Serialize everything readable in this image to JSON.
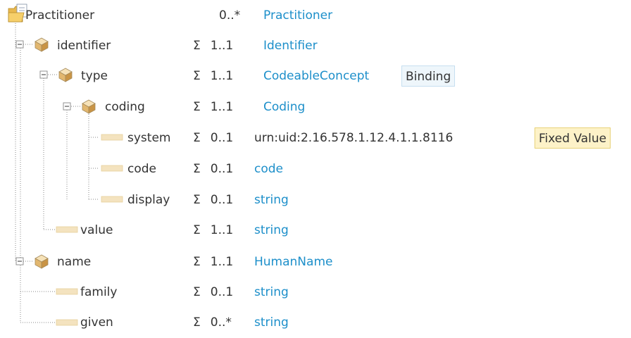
{
  "tree": {
    "rows": [
      {
        "name": "Practitioner",
        "flags": "",
        "card": "0..*",
        "type": "Practitioner",
        "badge": ""
      },
      {
        "name": "identifier",
        "flags": "Σ",
        "card": "1..1",
        "type": "Identifier",
        "badge": ""
      },
      {
        "name": "type",
        "flags": "Σ",
        "card": "1..1",
        "type": "CodeableConcept",
        "badge": "Binding"
      },
      {
        "name": "coding",
        "flags": "Σ",
        "card": "1..1",
        "type": "Coding",
        "badge": ""
      },
      {
        "name": "system",
        "flags": "Σ",
        "card": "0..1",
        "type": "urn:uid:2.16.578.1.12.4.1.1.8116",
        "badge": "Fixed Value"
      },
      {
        "name": "code",
        "flags": "Σ",
        "card": "0..1",
        "type": "code",
        "badge": ""
      },
      {
        "name": "display",
        "flags": "Σ",
        "card": "0..1",
        "type": "string",
        "badge": ""
      },
      {
        "name": "value",
        "flags": "Σ",
        "card": "1..1",
        "type": "string",
        "badge": ""
      },
      {
        "name": "name",
        "flags": "Σ",
        "card": "1..1",
        "type": "HumanName",
        "badge": ""
      },
      {
        "name": "family",
        "flags": "Σ",
        "card": "0..1",
        "type": "string",
        "badge": ""
      },
      {
        "name": "given",
        "flags": "Σ",
        "card": "0..*",
        "type": "string",
        "badge": ""
      }
    ]
  },
  "icons": {
    "root": "resource-folder-icon",
    "complex": "element-cube-icon",
    "primitive": "primitive-bar-icon",
    "expander": "collapse-minus-icon"
  },
  "colors": {
    "type_link": "#1d8fca",
    "text": "#333333",
    "binding_badge_bg": "#eef6fb",
    "fixed_badge_bg": "#fdf2c8",
    "tree_lines": "#888888"
  }
}
